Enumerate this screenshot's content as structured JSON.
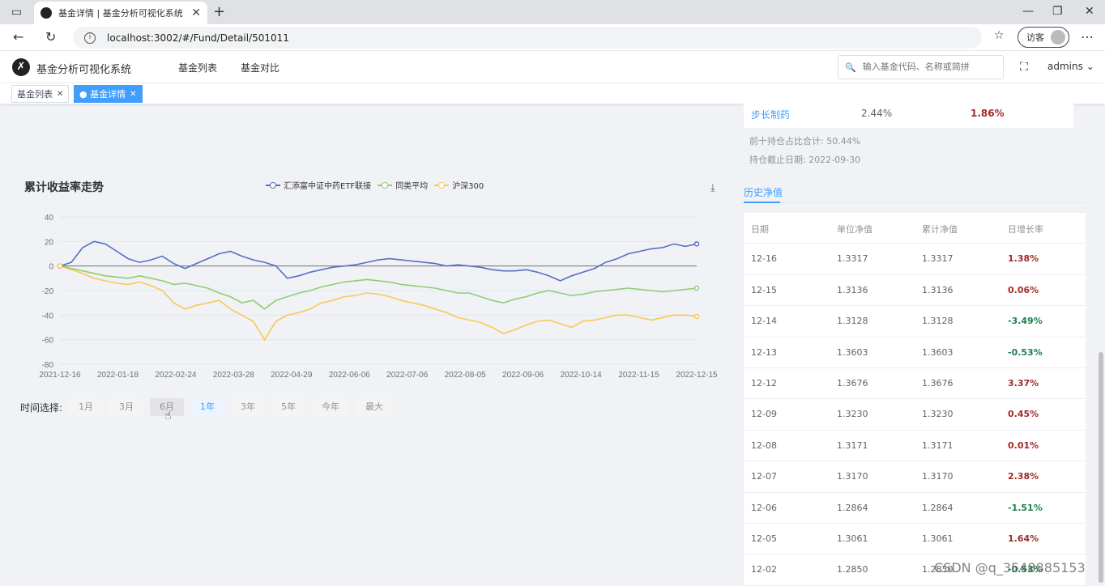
{
  "browser": {
    "tab_title": "基金详情 | 基金分析可视化系统",
    "url": "localhost:3002/#/Fund/Detail/501011",
    "guest_label": "访客"
  },
  "header": {
    "app_name": "基金分析可视化系统",
    "menu": [
      "基金列表",
      "基金对比"
    ],
    "search_placeholder": "输入基金代码、名称或简拼",
    "user": "admins"
  },
  "tags": [
    {
      "label": "基金列表",
      "active": false
    },
    {
      "label": "● 基金详情",
      "active": true
    }
  ],
  "holding_row": {
    "name": "步长制药",
    "ratio": "2.44%",
    "change": "1.86%"
  },
  "top10_sum": "前十持仓占比合计: 50.44%",
  "hold_date": "持仓截止日期: 2022-09-30",
  "history_tab": "历史净值",
  "history": {
    "headers": [
      "日期",
      "单位净值",
      "累计净值",
      "日增长率"
    ],
    "rows": [
      {
        "date": "12-16",
        "nav": "1.3317",
        "acc": "1.3317",
        "rate": "1.38%",
        "dir": "up"
      },
      {
        "date": "12-15",
        "nav": "1.3136",
        "acc": "1.3136",
        "rate": "0.06%",
        "dir": "up"
      },
      {
        "date": "12-14",
        "nav": "1.3128",
        "acc": "1.3128",
        "rate": "-3.49%",
        "dir": "down"
      },
      {
        "date": "12-13",
        "nav": "1.3603",
        "acc": "1.3603",
        "rate": "-0.53%",
        "dir": "down"
      },
      {
        "date": "12-12",
        "nav": "1.3676",
        "acc": "1.3676",
        "rate": "3.37%",
        "dir": "up"
      },
      {
        "date": "12-09",
        "nav": "1.3230",
        "acc": "1.3230",
        "rate": "0.45%",
        "dir": "up"
      },
      {
        "date": "12-08",
        "nav": "1.3171",
        "acc": "1.3171",
        "rate": "0.01%",
        "dir": "up"
      },
      {
        "date": "12-07",
        "nav": "1.3170",
        "acc": "1.3170",
        "rate": "2.38%",
        "dir": "up"
      },
      {
        "date": "12-06",
        "nav": "1.2864",
        "acc": "1.2864",
        "rate": "-1.51%",
        "dir": "down"
      },
      {
        "date": "12-05",
        "nav": "1.3061",
        "acc": "1.3061",
        "rate": "1.64%",
        "dir": "up"
      },
      {
        "date": "12-02",
        "nav": "1.2850",
        "acc": "1.2850",
        "rate": "-0.53%",
        "dir": "down"
      }
    ]
  },
  "time_select": {
    "label": "时间选择:",
    "options": [
      "1月",
      "3月",
      "6月",
      "1年",
      "3年",
      "5年",
      "今年",
      "最大"
    ],
    "active": "1年",
    "hover": "6月"
  },
  "watermark": "CSDN @q_3548885153",
  "chart_data": {
    "type": "line",
    "title": "累计收益率走势",
    "legend_position": "top",
    "ylim": [
      -80,
      40
    ],
    "yticks": [
      40,
      20,
      0,
      -20,
      -40,
      -60,
      -80
    ],
    "grid": true,
    "x_ticks": [
      "2021-12-16",
      "2022-01-18",
      "2022-02-24",
      "2022-03-28",
      "2022-04-29",
      "2022-06-06",
      "2022-07-06",
      "2022-08-05",
      "2022-09-06",
      "2022-10-14",
      "2022-11-15",
      "2022-12-15"
    ],
    "series": [
      {
        "name": "汇添富中证中药ETF联接",
        "color": "#5470c6",
        "values": [
          0,
          3,
          15,
          20,
          18,
          12,
          6,
          3,
          5,
          8,
          2,
          -2,
          2,
          6,
          10,
          12,
          8,
          5,
          3,
          0,
          -10,
          -8,
          -5,
          -3,
          -1,
          0,
          1,
          3,
          5,
          6,
          5,
          4,
          3,
          2,
          0,
          1,
          0,
          -1,
          -3,
          -4,
          -4,
          -3,
          -5,
          -8,
          -12,
          -8,
          -5,
          -2,
          3,
          6,
          10,
          12,
          14,
          15,
          18,
          16,
          18
        ]
      },
      {
        "name": "同类平均",
        "color": "#91cc75",
        "values": [
          0,
          -2,
          -4,
          -6,
          -8,
          -9,
          -10,
          -8,
          -10,
          -12,
          -15,
          -14,
          -16,
          -18,
          -22,
          -25,
          -30,
          -28,
          -35,
          -28,
          -25,
          -22,
          -20,
          -17,
          -15,
          -13,
          -12,
          -11,
          -12,
          -13,
          -15,
          -16,
          -17,
          -18,
          -20,
          -22,
          -22,
          -25,
          -28,
          -30,
          -27,
          -25,
          -22,
          -20,
          -22,
          -24,
          -23,
          -21,
          -20,
          -19,
          -18,
          -19,
          -20,
          -21,
          -20,
          -19,
          -18
        ]
      },
      {
        "name": "沪深300",
        "color": "#fac858",
        "values": [
          0,
          -3,
          -6,
          -10,
          -12,
          -14,
          -15,
          -13,
          -16,
          -20,
          -30,
          -35,
          -32,
          -30,
          -28,
          -35,
          -40,
          -45,
          -60,
          -45,
          -40,
          -38,
          -35,
          -30,
          -28,
          -25,
          -24,
          -22,
          -23,
          -25,
          -28,
          -30,
          -32,
          -35,
          -38,
          -42,
          -44,
          -46,
          -50,
          -55,
          -52,
          -48,
          -45,
          -44,
          -47,
          -50,
          -45,
          -44,
          -42,
          -40,
          -40,
          -42,
          -44,
          -42,
          -40,
          -40,
          -41
        ]
      }
    ]
  }
}
